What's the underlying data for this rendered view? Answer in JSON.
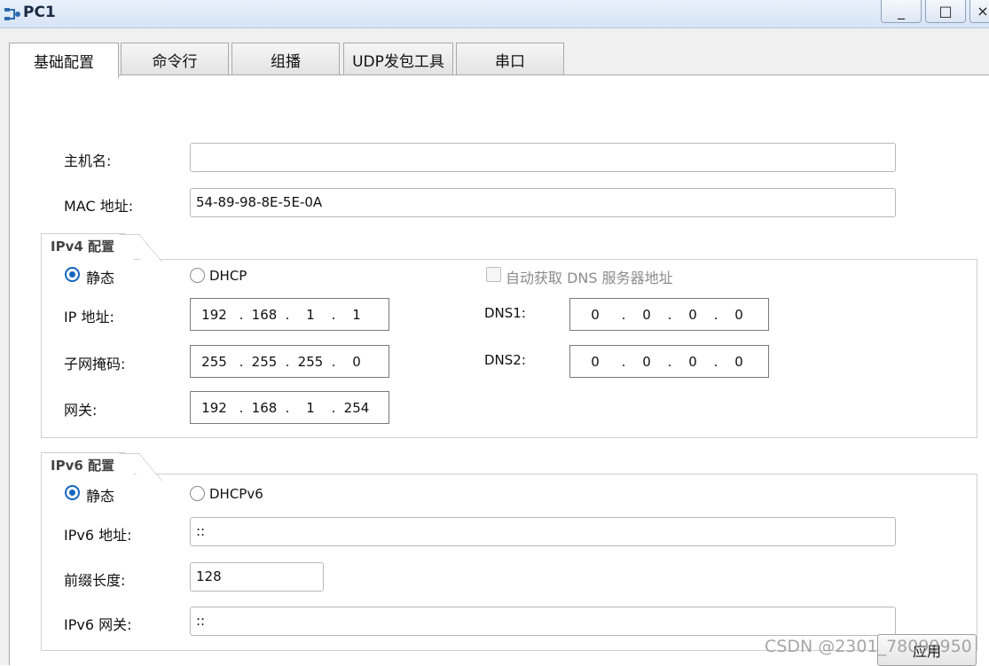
{
  "window": {
    "title": "PC1",
    "min_label": "_",
    "max_label": "□",
    "close_label": "×"
  },
  "tabs": [
    {
      "label": "基础配置",
      "active": true
    },
    {
      "label": "命令行",
      "active": false
    },
    {
      "label": "组播",
      "active": false
    },
    {
      "label": "UDP发包工具",
      "active": false
    },
    {
      "label": "串口",
      "active": false
    }
  ],
  "basic": {
    "hostname_label": "主机名:",
    "hostname_value": "",
    "mac_label": "MAC 地址:",
    "mac_value": "54-89-98-8E-5E-0A"
  },
  "ipv4": {
    "group_title": "IPv4 配置",
    "static_label": "静态",
    "dhcp_label": "DHCP",
    "mode": "static",
    "auto_dns_label": "自动获取 DNS 服务器地址",
    "auto_dns_checked": false,
    "ip_label": "IP 地址:",
    "ip": [
      "192",
      "168",
      "1",
      "1"
    ],
    "mask_label": "子网掩码:",
    "mask": [
      "255",
      "255",
      "255",
      "0"
    ],
    "gateway_label": "网关:",
    "gateway": [
      "192",
      "168",
      "1",
      "254"
    ],
    "dns1_label": "DNS1:",
    "dns1": [
      "0",
      "0",
      "0",
      "0"
    ],
    "dns2_label": "DNS2:",
    "dns2": [
      "0",
      "0",
      "0",
      "0"
    ]
  },
  "ipv6": {
    "group_title": "IPv6 配置",
    "static_label": "静态",
    "dhcp_label": "DHCPv6",
    "mode": "static",
    "addr_label": "IPv6 地址:",
    "addr_value": "::",
    "prefix_label": "前缀长度:",
    "prefix_value": "128",
    "gateway_label": "IPv6 网关:",
    "gateway_value": "::"
  },
  "apply_label": "应用",
  "watermark": "CSDN @2301_78099950",
  "colors": {
    "accent": "#1565c0",
    "titlebar": "#d6e4f5"
  }
}
